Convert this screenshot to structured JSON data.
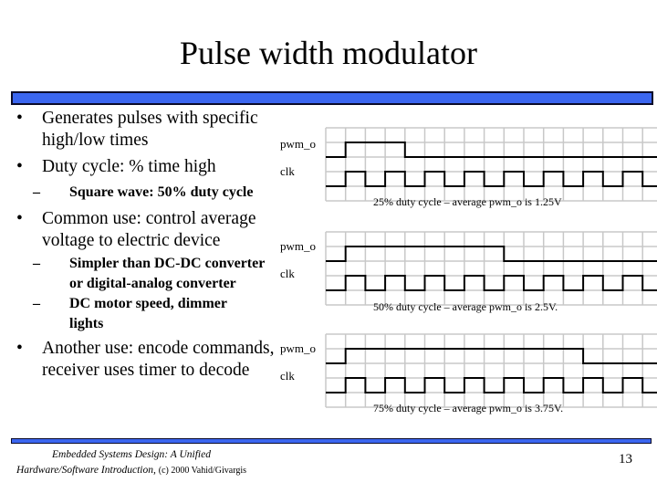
{
  "slide": {
    "title": "Pulse width modulator",
    "page_number": "13",
    "accent_color": "#3b66f0",
    "footer": {
      "line1": "Embedded Systems Design: A Unified",
      "line2_italic": "Hardware/Software Introduction,",
      "line2_plain": "(c) 2000 Vahid/Givargis"
    }
  },
  "bullets": [
    {
      "level": 1,
      "text": "Generates pulses with specific high/low times"
    },
    {
      "level": 1,
      "text": "Duty cycle: % time high"
    },
    {
      "level": 2,
      "text": "Square wave: 50% duty cycle"
    },
    {
      "level": 1,
      "text": "Common use: control average voltage to electric device"
    },
    {
      "level": 2,
      "text": "Simpler than DC-DC converter or digital-analog converter"
    },
    {
      "level": 2,
      "text": "DC motor speed, dimmer lights"
    },
    {
      "level": 1,
      "text": "Another use: encode commands, receiver uses timer to decode"
    }
  ],
  "diagrams": [
    {
      "pwm_label": "pwm_o",
      "clk_label": "clk",
      "duty_cycle_percent": 25,
      "pwm_high_clock_cycles": 1.5,
      "caption": "25% duty cycle – average pwm_o is 1.25V"
    },
    {
      "pwm_label": "pwm_o",
      "clk_label": "clk",
      "duty_cycle_percent": 50,
      "pwm_high_clock_cycles": 4,
      "caption": "50% duty cycle – average pwm_o is 2.5V."
    },
    {
      "pwm_label": "pwm_o",
      "clk_label": "clk",
      "duty_cycle_percent": 75,
      "pwm_high_clock_cycles": 6,
      "caption": "75% duty cycle – average pwm_o is 3.75V."
    }
  ],
  "waveform": {
    "grid_columns": 17,
    "grid_rows": 5,
    "clock_cycles_shown": 8.5,
    "pwm_start_column": 1
  }
}
